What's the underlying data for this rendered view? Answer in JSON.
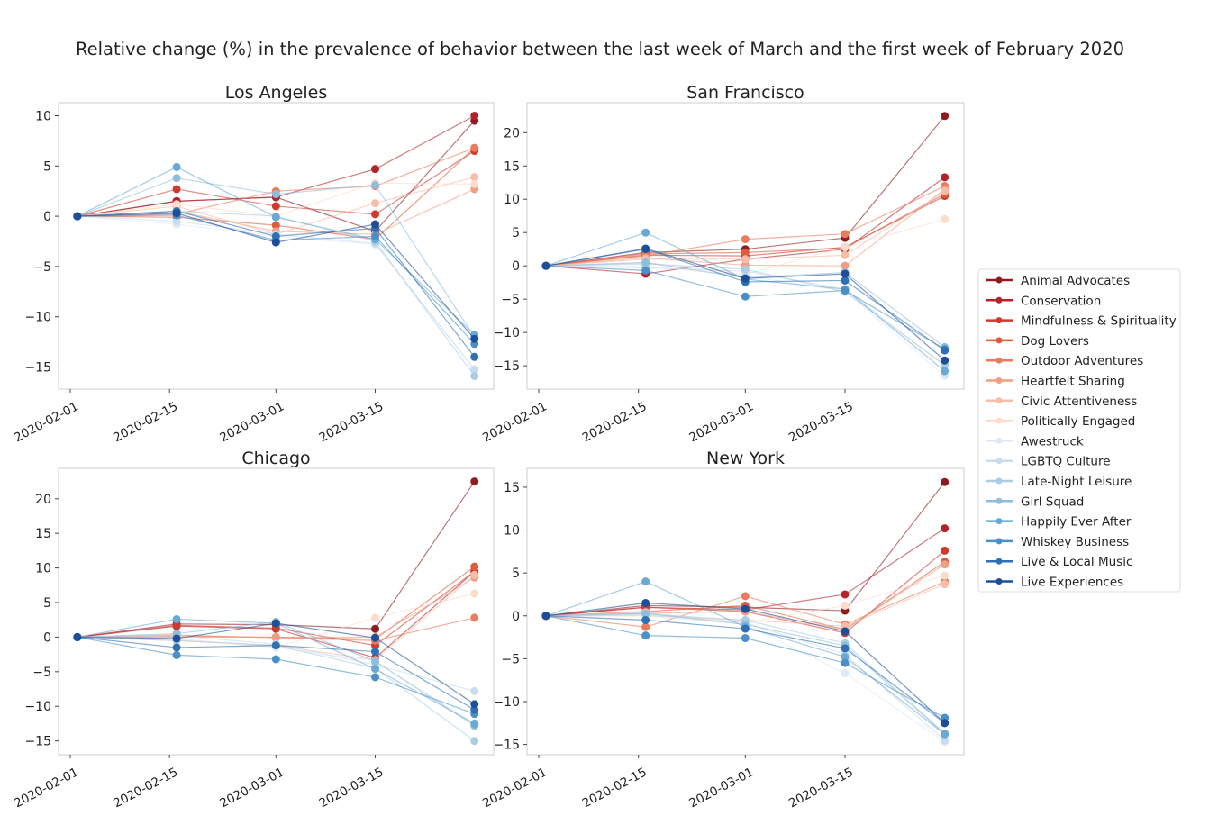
{
  "chart_data": {
    "type": "line",
    "title": "Relative change (%) in the prevalence of behavior between the last week of March and the first week of February 2020",
    "x": [
      "2020-02-02",
      "2020-02-16",
      "2020-03-01",
      "2020-03-15",
      "2020-03-29"
    ],
    "x_ticks": [
      "2020-02-01",
      "2020-02-15",
      "2020-03-01",
      "2020-03-15"
    ],
    "grid": false,
    "markers": true,
    "legend_placement": "right",
    "legend": [
      "Animal Advocates",
      "Conservation",
      "Mindfulness & Spirituality",
      "Dog Lovers",
      "Outdoor Adventures",
      "Heartfelt Sharing",
      "Civic Attentiveness",
      "Politically Engaged",
      "Awestruck",
      "LGBTQ Culture",
      "Late-Night Leisure",
      "Girl Squad",
      "Happily Ever After",
      "Whiskey Business",
      "Live & Local Music",
      "Live Experiences"
    ],
    "colors": [
      "#8e1b1f",
      "#b3242a",
      "#d0392d",
      "#e05a3d",
      "#ea7c5e",
      "#f19e82",
      "#f6bda7",
      "#fbdccd",
      "#dde9f6",
      "#c8dcef",
      "#abcde4",
      "#8fbedb",
      "#6aa9d4",
      "#4a8fc7",
      "#2f6fb4",
      "#1c4f98"
    ],
    "panels": [
      {
        "title": "Los Angeles",
        "ylim": [
          -17.2,
          11.3
        ],
        "y_ticks": [
          10,
          5,
          0,
          -5,
          -10,
          -15
        ],
        "series": [
          [
            0,
            1.5,
            1.9,
            -1.5,
            9.5
          ],
          [
            0,
            1.5,
            1.9,
            4.7,
            10
          ],
          [
            0,
            2.7,
            1.0,
            0.2,
            6.5
          ],
          [
            0,
            -0.1,
            -0.9,
            -2.3,
            6.8
          ],
          [
            0,
            0.2,
            2.5,
            3.0,
            6.8
          ],
          [
            0,
            0.5,
            -1.5,
            -1.8,
            2.7
          ],
          [
            0,
            1.0,
            -1.8,
            1.3,
            3.9
          ],
          [
            0,
            1.2,
            0,
            3.3,
            3.2
          ],
          [
            0,
            -0.8,
            -2.0,
            -2.8,
            -15.2
          ],
          [
            0,
            -0.5,
            -1.8,
            -2.7,
            -15.3
          ],
          [
            0,
            0.5,
            0,
            -2.5,
            -15.9
          ],
          [
            0,
            3.8,
            2.2,
            3.1,
            -12
          ],
          [
            0,
            4.9,
            -0.1,
            -2.3,
            -11.8
          ],
          [
            0,
            0.1,
            -2.4,
            -2.0,
            -12.7
          ],
          [
            0,
            0.5,
            -2.0,
            -1.2,
            -14
          ],
          [
            0,
            0.3,
            -2.6,
            -0.8,
            -12.2
          ]
        ]
      },
      {
        "title": "San Francisco",
        "ylim": [
          -18.5,
          24.5
        ],
        "y_ticks": [
          20,
          15,
          10,
          5,
          0,
          -5,
          -10,
          -15
        ],
        "series": [
          [
            0,
            2.0,
            2.5,
            4.2,
            22.5
          ],
          [
            0,
            -1.2,
            1.0,
            2.5,
            13.3
          ],
          [
            0,
            1.6,
            1.5,
            2.8,
            10.5
          ],
          [
            0,
            1.8,
            2.0,
            2.7,
            10.8
          ],
          [
            0,
            1.5,
            4.0,
            4.8,
            12
          ],
          [
            0,
            1.2,
            0.1,
            0,
            11.5
          ],
          [
            0,
            1.0,
            1.0,
            1.6,
            11.2
          ],
          [
            0,
            0.5,
            -1.3,
            2.8,
            7
          ],
          [
            0,
            0,
            -1.5,
            -3.8,
            -16.5
          ],
          [
            0,
            -0.3,
            -0.8,
            -3.5,
            -15
          ],
          [
            0,
            0.3,
            -0.5,
            -3.9,
            -14.9
          ],
          [
            0,
            0.5,
            -1.8,
            -1.0,
            -12.2
          ],
          [
            0,
            5,
            -2.0,
            -3.5,
            -15.8
          ],
          [
            0,
            -0.7,
            -4.6,
            -3.7,
            -12.5
          ],
          [
            0,
            2.5,
            -2.4,
            -2.2,
            -12.7
          ],
          [
            0,
            2.6,
            -1.9,
            -1.2,
            -14.2
          ]
        ]
      },
      {
        "title": "Chicago",
        "ylim": [
          -17,
          24.4
        ],
        "y_ticks": [
          20,
          15,
          10,
          5,
          0,
          -5,
          -10,
          -15
        ],
        "series": [
          [
            0,
            1.9,
            1.8,
            1.2,
            22.5
          ],
          [
            0,
            1.6,
            1.2,
            -3.0,
            9.5
          ],
          [
            0,
            1.7,
            1.3,
            -1.2,
            9.5
          ],
          [
            0,
            0.1,
            0,
            -0.3,
            10.2
          ],
          [
            0,
            0.3,
            -0.1,
            -0.5,
            2.8
          ],
          [
            0,
            0,
            0,
            0,
            8.6
          ],
          [
            0,
            -0.5,
            -1.2,
            -3.3,
            9.0
          ],
          [
            0,
            -0.3,
            -1.5,
            2.8,
            6.3
          ],
          [
            0,
            -0.2,
            -1.5,
            -3.5,
            -12.5
          ],
          [
            0,
            0.2,
            -1.0,
            -4.0,
            -7.8
          ],
          [
            0,
            -0.5,
            -1.2,
            -4.5,
            -15
          ],
          [
            0,
            0.5,
            2.2,
            -3.5,
            -12.8
          ],
          [
            0,
            2.6,
            2.0,
            -4.6,
            -12.5
          ],
          [
            0,
            -2.6,
            -3.2,
            -5.8,
            -11.1
          ],
          [
            0,
            -1.5,
            -1.2,
            -2.1,
            -10.5
          ],
          [
            0,
            -0.2,
            2.0,
            -0.1,
            -9.7
          ]
        ]
      },
      {
        "title": "New York",
        "ylim": [
          -16.2,
          17.2
        ],
        "y_ticks": [
          15,
          10,
          5,
          0,
          -5,
          -10,
          -15
        ],
        "series": [
          [
            0,
            1.2,
            1.0,
            0.6,
            15.6
          ],
          [
            0,
            1.0,
            0.7,
            2.5,
            10.2
          ],
          [
            0,
            1.0,
            0.5,
            -2.0,
            7.6
          ],
          [
            0,
            0.5,
            1.2,
            -1.6,
            6.3
          ],
          [
            0,
            -1.3,
            2.3,
            -1.0,
            4.0
          ],
          [
            0,
            0.3,
            0.5,
            -1.6,
            6.0
          ],
          [
            0,
            0,
            -0.5,
            -1.2,
            3.7
          ],
          [
            0,
            0.4,
            -0.8,
            1.2,
            4.7
          ],
          [
            0,
            0,
            -1.0,
            -6.7,
            -14.7
          ],
          [
            0,
            0.1,
            -0.8,
            -4.5,
            -14.5
          ],
          [
            0,
            0.2,
            -0.5,
            -3.2,
            -13.7
          ],
          [
            0,
            0.3,
            -1.0,
            -3.5,
            -13.8
          ],
          [
            0,
            4.0,
            -1.3,
            -4.8,
            -13.8
          ],
          [
            0,
            -2.3,
            -2.6,
            -5.5,
            -11.9
          ],
          [
            0,
            -0.5,
            -1.5,
            -3.8,
            -12.5
          ],
          [
            0,
            1.5,
            0.8,
            -1.8,
            -12.5
          ]
        ]
      }
    ]
  }
}
